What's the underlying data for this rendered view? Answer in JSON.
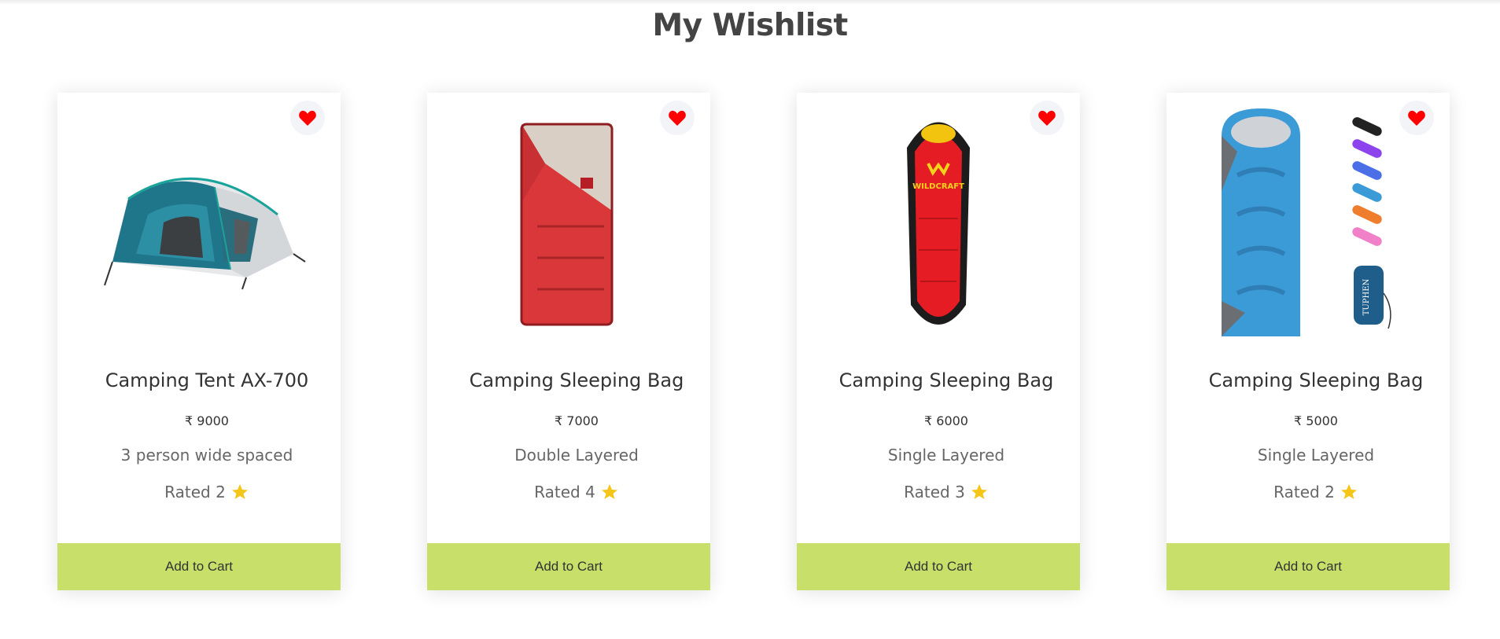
{
  "page": {
    "title": "My Wishlist"
  },
  "colors": {
    "accent": "#c8e06a",
    "heart": "#ff0000",
    "star": "#f5c518",
    "title": "#444444"
  },
  "icons": {
    "wishlist": "heart-icon",
    "rating": "star-icon",
    "currency": "rupee"
  },
  "products": [
    {
      "name": "Camping Tent AX-700",
      "price": "₹ 9000",
      "description": "3 person wide spaced",
      "rating": "Rated 2",
      "button": "Add to Cart",
      "image": "tent"
    },
    {
      "name": "Camping Sleeping Bag",
      "price": "₹ 7000",
      "description": "Double Layered",
      "rating": "Rated 4",
      "button": "Add to Cart",
      "image": "red-rectangular-sleeping-bag"
    },
    {
      "name": "Camping Sleeping Bag",
      "price": "₹ 6000",
      "description": "Single Layered",
      "rating": "Rated 3",
      "button": "Add to Cart",
      "image": "red-mummy-sleeping-bag",
      "logo_text": "WILDCRAFT"
    },
    {
      "name": "Camping Sleeping Bag",
      "price": "₹ 5000",
      "description": "Single Layered",
      "rating": "Rated 2",
      "button": "Add to Cart",
      "image": "blue-sleeping-bag-set",
      "logo_text": "TUPHEN"
    }
  ]
}
